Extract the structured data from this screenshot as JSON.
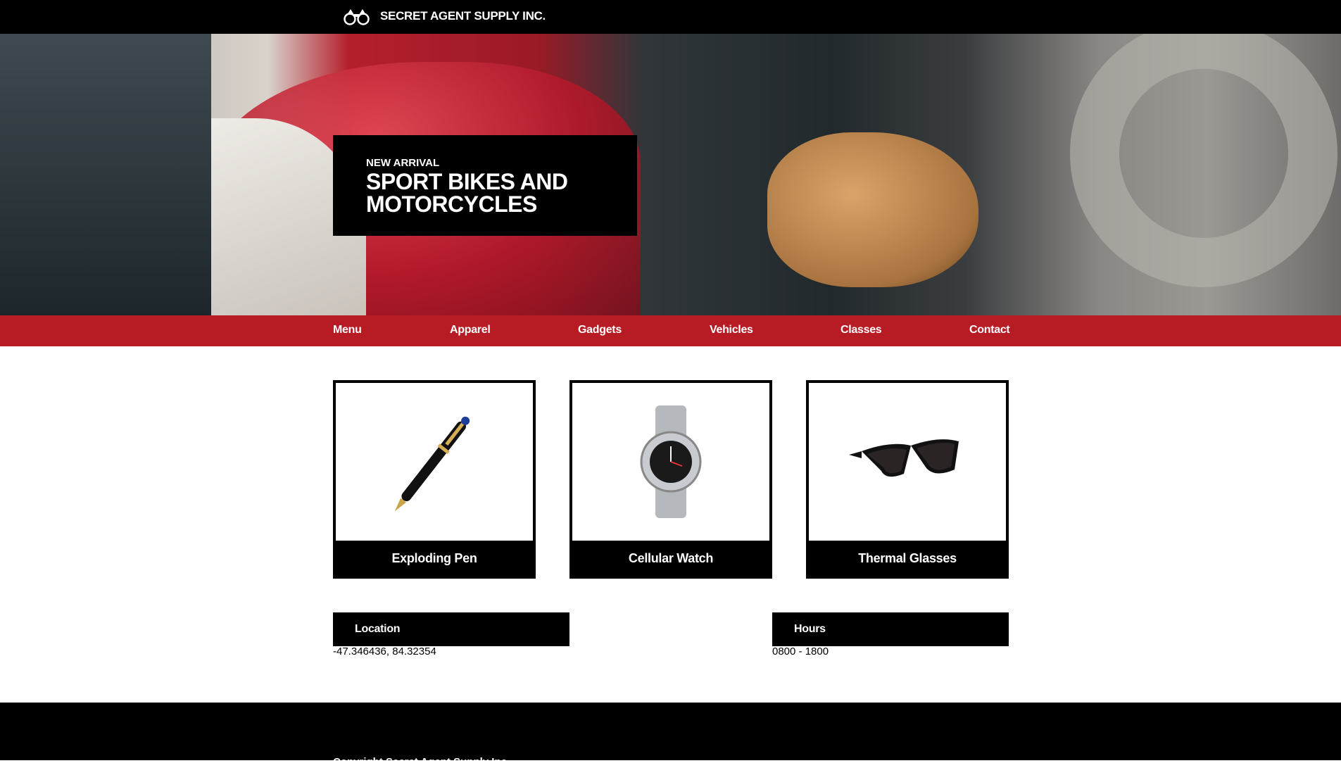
{
  "header": {
    "brand": "SECRET AGENT SUPPLY INC.",
    "logo_icon": "binoculars-icon"
  },
  "hero": {
    "kicker": "NEW ARRIVAL",
    "title": "SPORT BIKES AND MOTORCYCLES"
  },
  "nav": {
    "items": [
      "Menu",
      "Apparel",
      "Gadgets",
      "Vehicles",
      "Classes",
      "Contact"
    ]
  },
  "products": [
    {
      "name": "Exploding Pen"
    },
    {
      "name": "Cellular Watch"
    },
    {
      "name": "Thermal Glasses"
    }
  ],
  "info": {
    "location_label": "Location",
    "location_value": "-47.346436, 84.32354",
    "hours_label": "Hours",
    "hours_value": "0800 - 1800"
  },
  "footer": {
    "copyright": "Copyright Secret Agent Supply Inc."
  },
  "colors": {
    "nav": "#b71c25",
    "header": "#000000"
  }
}
